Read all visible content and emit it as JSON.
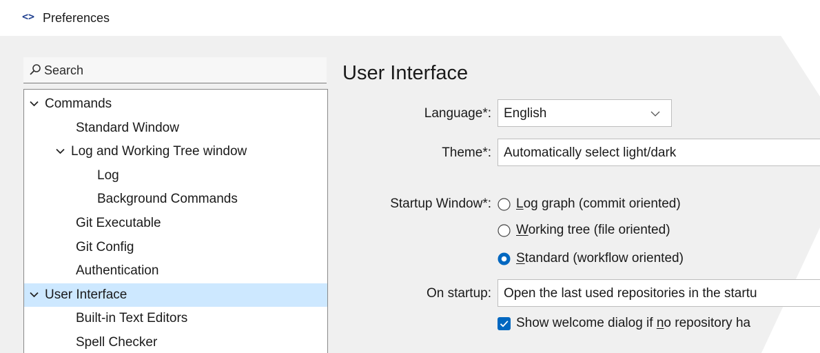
{
  "window": {
    "title": "Preferences",
    "app_icon": "code-brackets-icon"
  },
  "search": {
    "placeholder": "Search",
    "icon": "search-icon"
  },
  "tree": {
    "items": [
      {
        "label": "Commands",
        "level": 0,
        "expanded": true,
        "selected": false
      },
      {
        "label": "Standard Window",
        "level": 1,
        "expanded": false,
        "selected": false
      },
      {
        "label": "Log and Working Tree window",
        "level": 1,
        "expanded": true,
        "selected": false
      },
      {
        "label": "Log",
        "level": 2,
        "expanded": false,
        "selected": false
      },
      {
        "label": "Background Commands",
        "level": 2,
        "expanded": false,
        "selected": false
      },
      {
        "label": "Git Executable",
        "level": 1,
        "expanded": false,
        "selected": false
      },
      {
        "label": "Git Config",
        "level": 1,
        "expanded": false,
        "selected": false
      },
      {
        "label": "Authentication",
        "level": 1,
        "expanded": false,
        "selected": false
      },
      {
        "label": "User Interface",
        "level": 0,
        "expanded": true,
        "selected": true
      },
      {
        "label": "Built-in Text Editors",
        "level": 1,
        "expanded": false,
        "selected": false
      },
      {
        "label": "Spell Checker",
        "level": 1,
        "expanded": false,
        "selected": false
      }
    ]
  },
  "panel": {
    "title": "User Interface",
    "language": {
      "label": "Language*:",
      "value": "English"
    },
    "theme": {
      "label": "Theme*:",
      "value": "Automatically select light/dark"
    },
    "startup_window": {
      "label": "Startup Window*:",
      "options": [
        {
          "mnemonic": "L",
          "rest": "og graph (commit oriented)",
          "checked": false
        },
        {
          "mnemonic": "W",
          "rest": "orking tree (file oriented)",
          "checked": false
        },
        {
          "mnemonic": "S",
          "rest": "tandard (workflow oriented)",
          "checked": true
        }
      ]
    },
    "on_startup": {
      "label": "On startup:",
      "value": "Open the last used repositories in the startu"
    },
    "welcome": {
      "before": "Show welcome dialog if ",
      "mnemonic": "n",
      "after": "o repository ha",
      "checked": true
    }
  },
  "colors": {
    "accent": "#0067c0",
    "selection": "#cde8ff"
  }
}
